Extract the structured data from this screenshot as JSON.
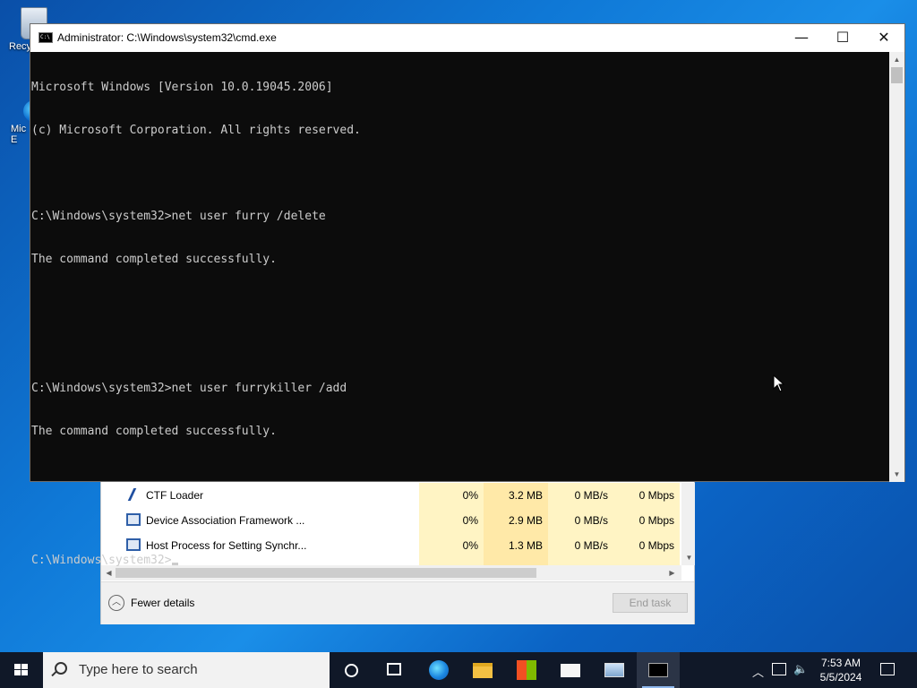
{
  "desktop": {
    "icons": [
      {
        "label": "Recycle Bin",
        "visible_text": "Recy"
      },
      {
        "label": "Microsoft Edge",
        "visible_text": "Mic\nE"
      }
    ]
  },
  "cmd_window": {
    "title": "Administrator: C:\\Windows\\system32\\cmd.exe",
    "minimize": "—",
    "maximize": "☐",
    "close": "✕",
    "lines": [
      "Microsoft Windows [Version 10.0.19045.2006]",
      "(c) Microsoft Corporation. All rights reserved.",
      "",
      "C:\\Windows\\system32>net user furry /delete",
      "The command completed successfully.",
      "",
      "",
      "C:\\Windows\\system32>net user furrykiller /add",
      "The command completed successfully.",
      "",
      "",
      "C:\\Windows\\system32>"
    ]
  },
  "task_manager": {
    "rows": [
      {
        "name": "CTF Loader",
        "cpu": "0%",
        "memory": "3.2 MB",
        "disk": "0 MB/s",
        "network": "0 Mbps",
        "icon": "pen-icon"
      },
      {
        "name": "Device Association Framework ...",
        "cpu": "0%",
        "memory": "2.9 MB",
        "disk": "0 MB/s",
        "network": "0 Mbps",
        "icon": "window-icon"
      },
      {
        "name": "Host Process for Setting Synchr...",
        "cpu": "0%",
        "memory": "1.3 MB",
        "disk": "0 MB/s",
        "network": "0 Mbps",
        "icon": "window-icon"
      }
    ],
    "fewer_details": "Fewer details",
    "end_task": "End task"
  },
  "taskbar": {
    "search_placeholder": "Type here to search",
    "time": "7:53 AM",
    "date": "5/5/2024",
    "apps": [
      "cortana-icon",
      "task-view-icon",
      "edge-icon",
      "file-explorer-icon",
      "store-icon",
      "mail-icon",
      "network-computer-icon",
      "cmd-icon"
    ]
  },
  "colors": {
    "console_bg": "#0c0c0c",
    "console_text": "#cccccc",
    "taskbar_bg": "#101828",
    "highlight_col": "#fff4c4"
  }
}
